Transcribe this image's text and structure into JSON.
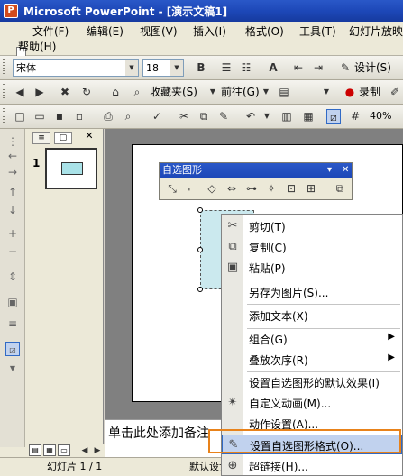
{
  "window": {
    "title": "Microsoft PowerPoint - [演示文稿1]",
    "app_icon_glyph": "P"
  },
  "menu": {
    "items": [
      "文件(F)",
      "编辑(E)",
      "视图(V)",
      "插入(I)",
      "格式(O)",
      "工具(T)",
      "幻灯片放映"
    ],
    "help": "帮助(H)"
  },
  "format_toolbar": {
    "font": "宋体",
    "size": "18",
    "bold": "B",
    "design": "设计(S)"
  },
  "web_toolbar": {
    "favorites": "收藏夹(S)",
    "go": "前往(G)",
    "record": "录制"
  },
  "standard_toolbar": {
    "zoom": "40%"
  },
  "thumbnail_panel": {
    "slide_number": "1"
  },
  "autoshape_palette": {
    "title": "自选图形"
  },
  "notes": {
    "placeholder": "单击此处添加备注"
  },
  "status": {
    "slide": "幻灯片 1 / 1",
    "design": "默认设计"
  },
  "context_menu": {
    "items": [
      {
        "label": "剪切(T)",
        "icon": "scissors-icon"
      },
      {
        "label": "复制(C)",
        "icon": "copy-icon"
      },
      {
        "label": "粘贴(P)",
        "icon": "paste-icon"
      },
      {
        "label": "另存为图片(S)...",
        "icon": ""
      },
      {
        "label": "添加文本(X)",
        "icon": ""
      },
      {
        "label": "组合(G)",
        "icon": "",
        "submenu": true
      },
      {
        "label": "叠放次序(R)",
        "icon": "",
        "submenu": true
      },
      {
        "label": "设置自选图形的默认效果(I)",
        "icon": ""
      },
      {
        "label": "自定义动画(M)...",
        "icon": "custom-animation-icon"
      },
      {
        "label": "动作设置(A)...",
        "icon": ""
      },
      {
        "label": "设置自选图形格式(O)...",
        "icon": "format-shape-icon",
        "highlighted": true
      },
      {
        "label": "超链接(H)...",
        "icon": "hyperlink-icon"
      }
    ]
  },
  "colors": {
    "title_bar": "#1d48b8",
    "highlight_border": "#e8821a",
    "shape_fill": "#cbe9ee"
  }
}
